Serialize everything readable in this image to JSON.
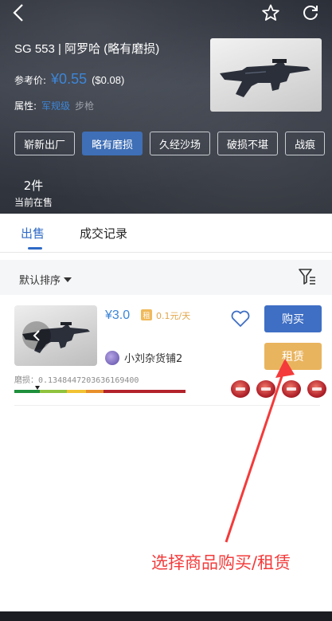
{
  "header": {
    "title": "SG 553 | 阿罗哈 (略有磨损)",
    "price_label": "参考价:",
    "price_main": "¥0.55",
    "price_usd": "($0.08)",
    "attr_label": "属性:",
    "attr_grade": "军规级",
    "attr_type": "步枪",
    "wear_chips": [
      "崭新出厂",
      "略有磨损",
      "久经沙场",
      "破损不堪",
      "战痕"
    ],
    "active_chip": "略有磨损",
    "on_sale_count": "2件",
    "on_sale_label": "当前在售"
  },
  "tabs": {
    "sell": "出售",
    "history": "成交记录",
    "active": "出售"
  },
  "sort": {
    "label": "默认排序"
  },
  "listing": {
    "price": "¥3.0",
    "rent_tag": "租",
    "rent_price": "0.1元/天",
    "seller": "小刘杂货铺2",
    "wear": "磨损：0.1348447203636169400",
    "wear_value": 0.1348447203636169,
    "buy": "购买",
    "rent": "租赁"
  },
  "annotation": "选择商品购买/租赁",
  "colors": {
    "accent": "#3d86d8",
    "buy_button": "#3f6fc4",
    "rent_button": "#e9b45e",
    "annotation": "#f43a3a"
  },
  "icons": [
    "back-icon",
    "star-icon",
    "refresh-icon",
    "heart-icon",
    "filter-icon",
    "sticker-icon"
  ]
}
